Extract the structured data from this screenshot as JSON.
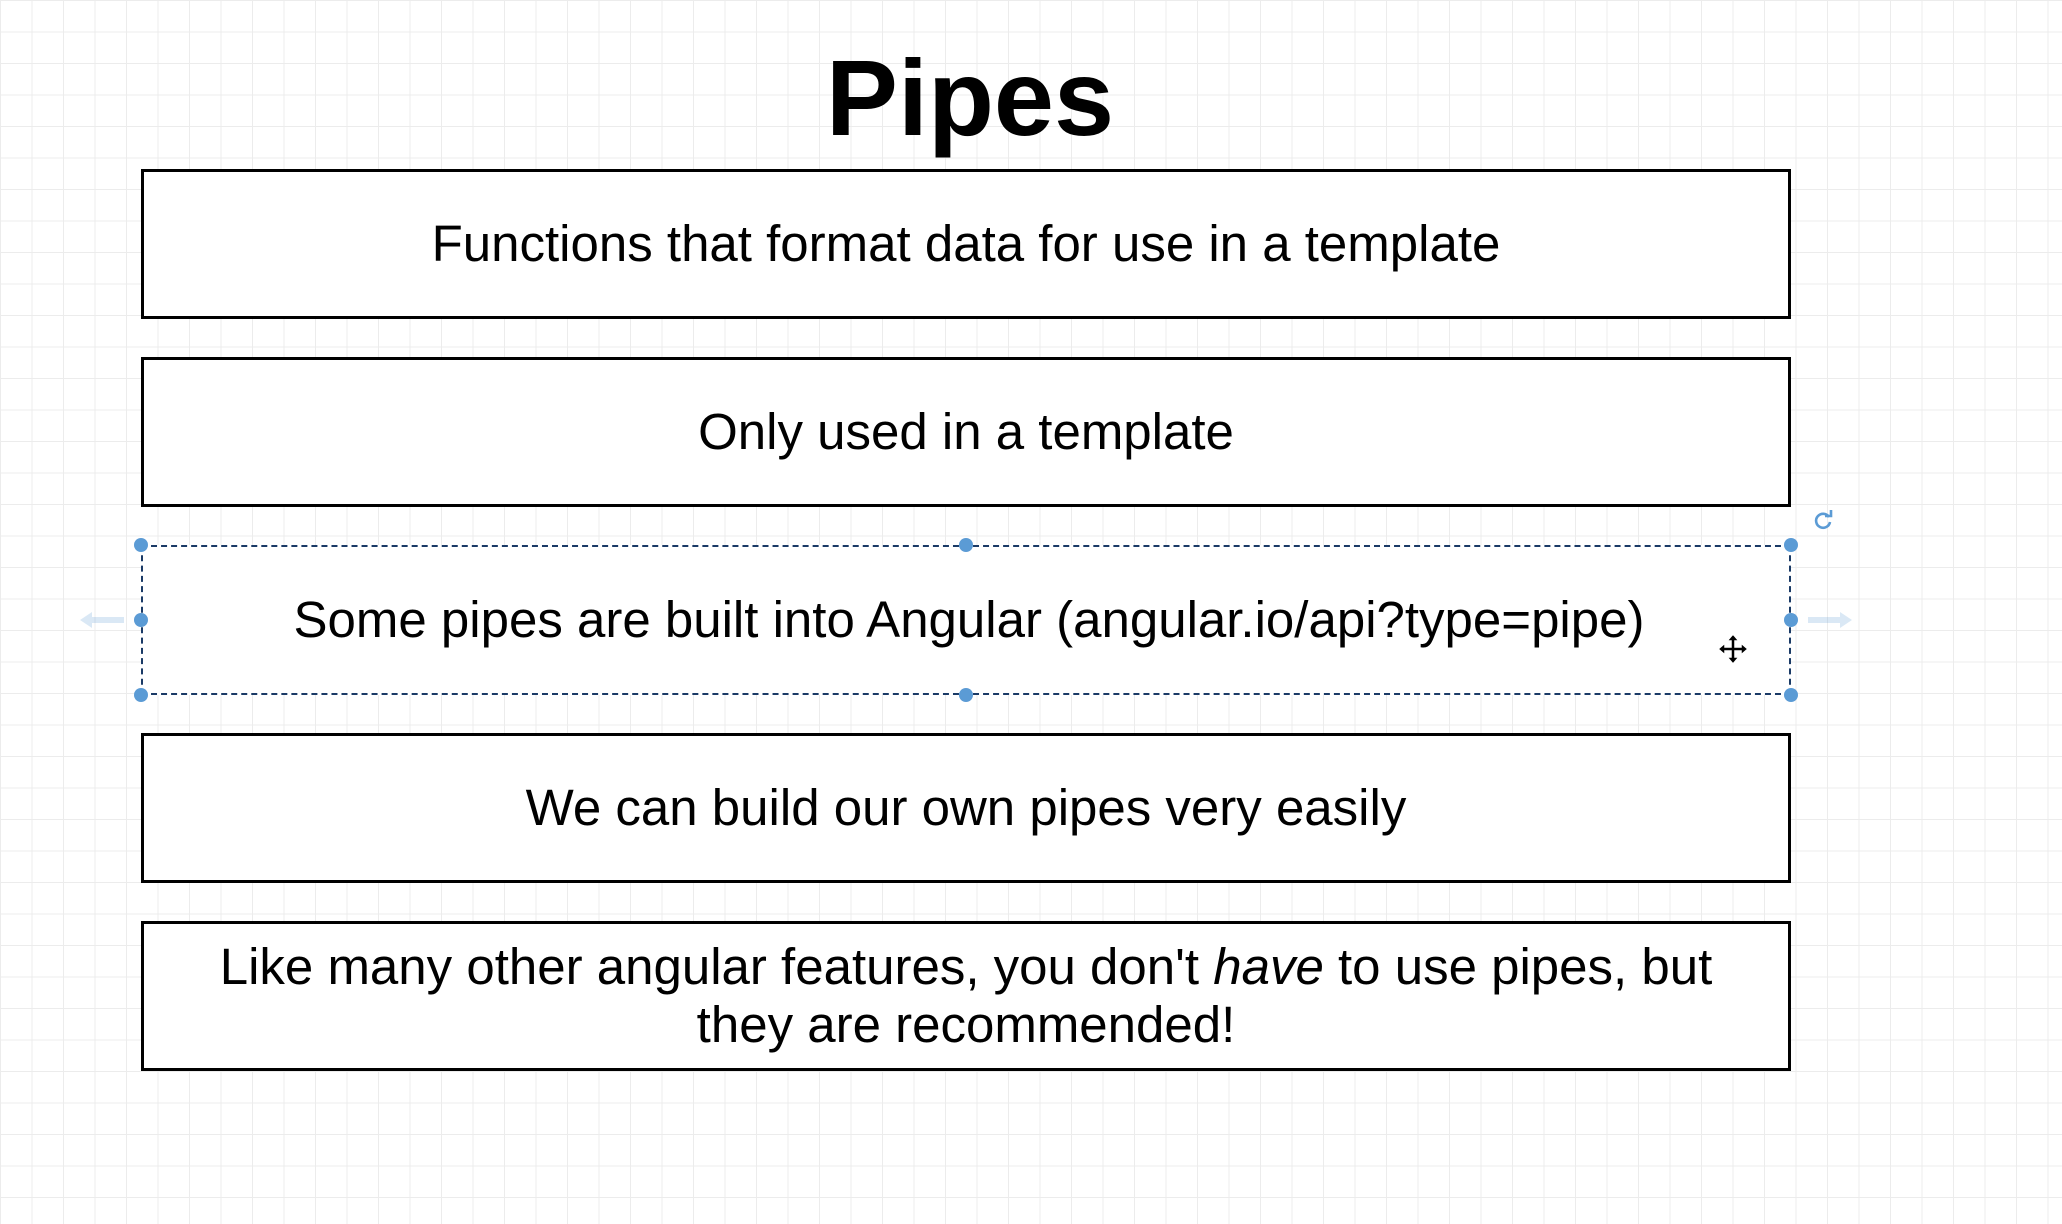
{
  "title": "Pipes",
  "boxes": [
    {
      "text": "Functions that format data for use in a template"
    },
    {
      "text": "Only used in a template"
    },
    {
      "text": "Some pipes are built into Angular (angular.io/api?type=pipe)"
    },
    {
      "text": "We can build our own pipes very easily"
    },
    {
      "line1_before": "Like many other angular features, you don't ",
      "line1_em": "have",
      "line1_after": " to use pipes, but",
      "line2": "they are recommended!"
    }
  ],
  "colors": {
    "handle": "#5b9bd5",
    "selection_border": "#1a3a66",
    "grid": "#ececec"
  },
  "icons": {
    "rotate": "rotate-icon",
    "move": "move-cursor-icon",
    "left_arrow": "arrow-left-icon",
    "right_arrow": "arrow-right-icon"
  }
}
